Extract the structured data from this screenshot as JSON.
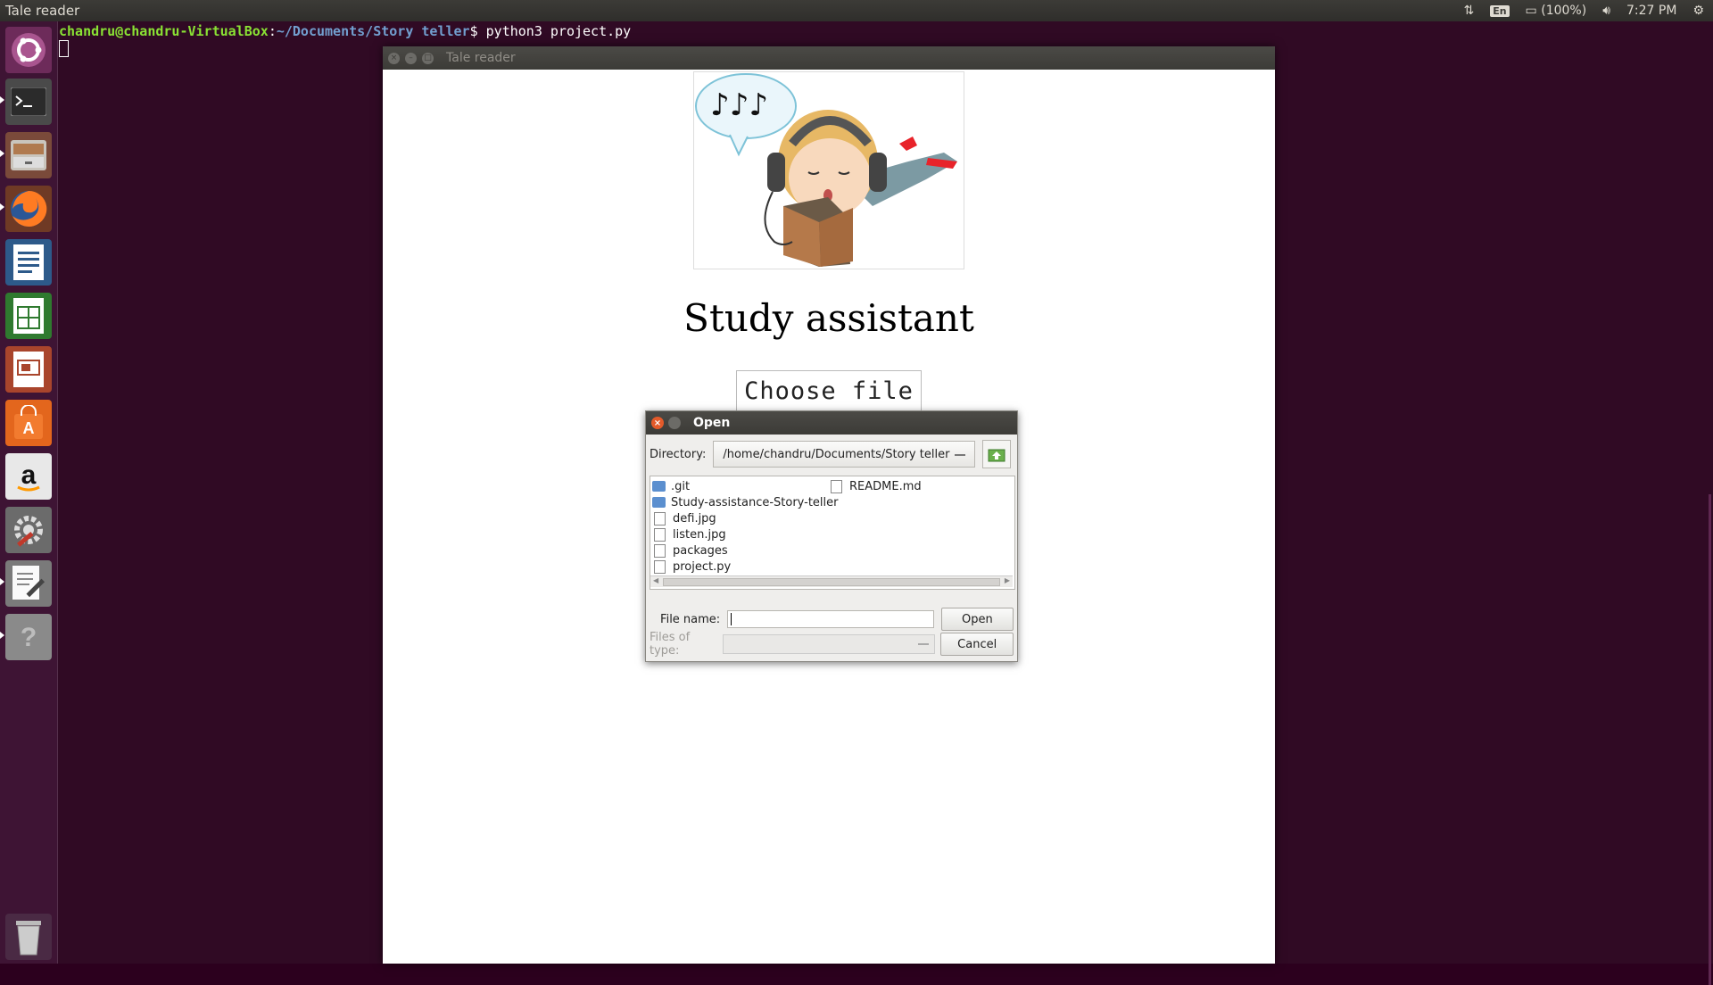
{
  "top_panel": {
    "app_title": "Tale reader",
    "keyboard_layout": "En",
    "battery_text": "(100%)",
    "clock": "7:27 PM"
  },
  "terminal": {
    "user_host": "chandru@chandru-VirtualBox",
    "separator": ":",
    "path": "~/Documents/Story teller",
    "prompt_end": "$ ",
    "command": "python3 project.py"
  },
  "launcher": {
    "items": [
      "dash",
      "terminal",
      "files",
      "firefox",
      "writer",
      "calc",
      "impress",
      "software-center",
      "amazon",
      "system-settings",
      "text-editor",
      "help",
      "trash"
    ]
  },
  "app_window": {
    "title": "Tale reader",
    "heading": "Study assistant",
    "choose_label": "Choose file"
  },
  "dialog": {
    "title": "Open",
    "directory_label": "Directory:",
    "directory_value": "/home/chandru/Documents/Story teller",
    "files": [
      {
        "name": ".git",
        "type": "folder"
      },
      {
        "name": "Study-assistance-Story-teller",
        "type": "folder"
      },
      {
        "name": "defi.jpg",
        "type": "file"
      },
      {
        "name": "listen.jpg",
        "type": "file"
      },
      {
        "name": "packages",
        "type": "file"
      },
      {
        "name": "project.py",
        "type": "file"
      },
      {
        "name": "README.md",
        "type": "file"
      }
    ],
    "file_name_label": "File name:",
    "file_name_value": "",
    "files_of_type_label": "Files of type:",
    "open_label": "Open",
    "cancel_label": "Cancel"
  },
  "colors": {
    "terminal_bg": "#300a24",
    "prompt_user": "#8ae234",
    "prompt_path": "#729fcf",
    "close_button": "#e45a2a"
  }
}
